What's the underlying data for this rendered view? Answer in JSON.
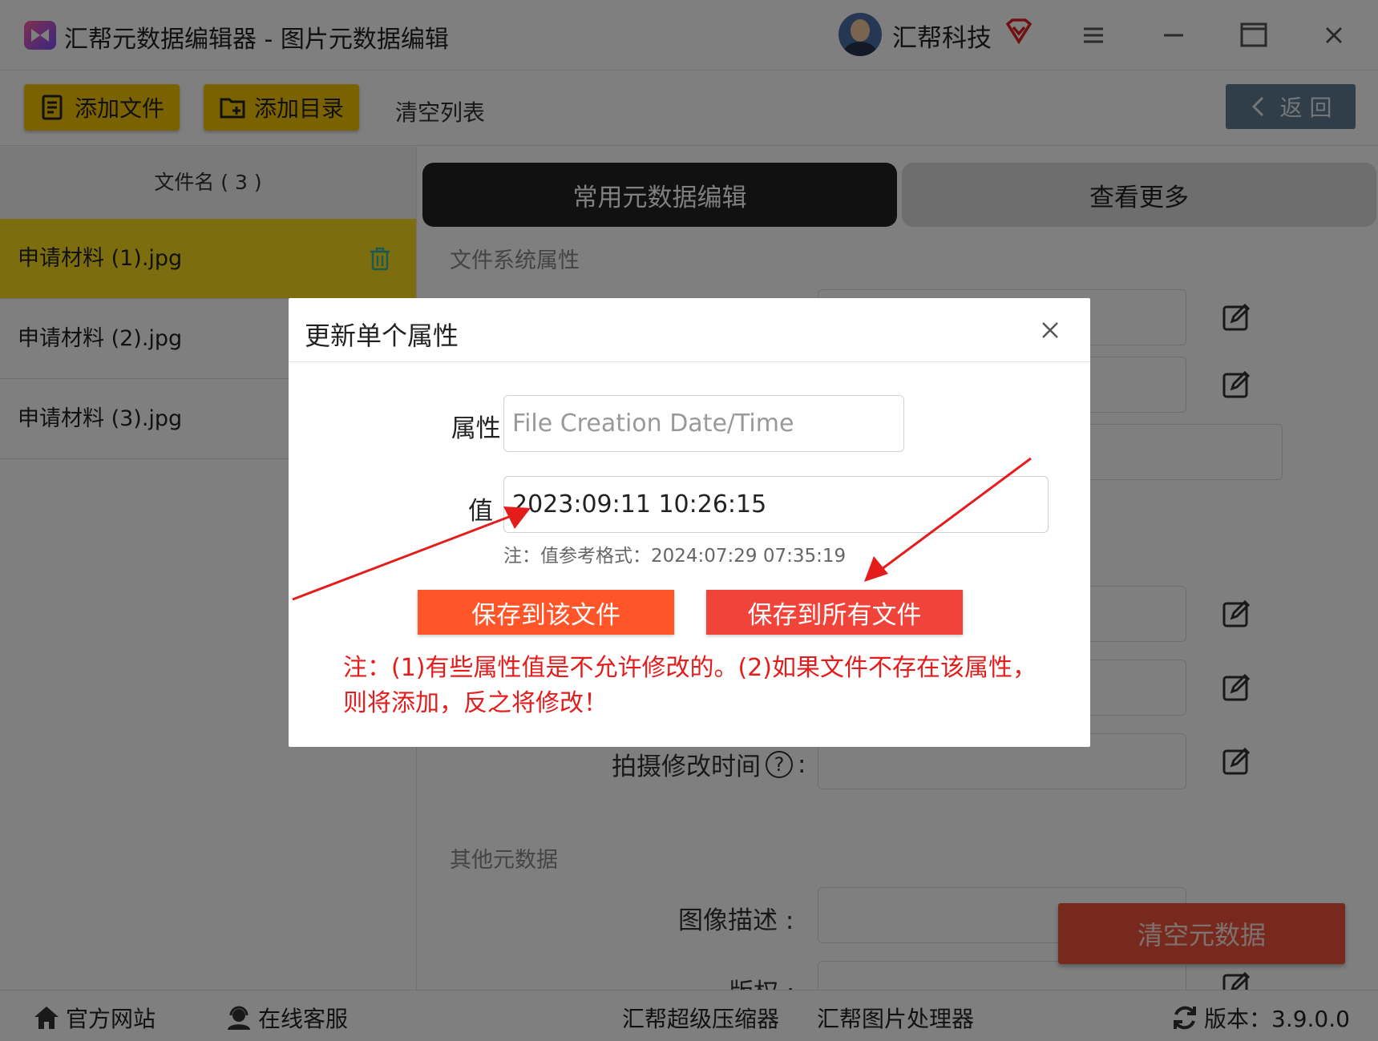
{
  "app": {
    "title": "汇帮元数据编辑器 - 图片元数据编辑"
  },
  "user": {
    "name": "汇帮科技"
  },
  "toolbar": {
    "add_file": "添加文件",
    "add_dir": "添加目录",
    "clear_list": "清空列表",
    "back": "返 回"
  },
  "file_list": {
    "header": "文件名 ( 3 )",
    "files": [
      {
        "name": "申请材料 (1).jpg",
        "active": true
      },
      {
        "name": "申请材料 (2).jpg",
        "active": false
      },
      {
        "name": "申请材料 (3).jpg",
        "active": false
      }
    ]
  },
  "main": {
    "tab_common": "常用元数据编辑",
    "tab_more": "查看更多",
    "section_fs": "文件系统属性",
    "section_other": "其他元数据",
    "label_shot_modified": "拍摄修改时间",
    "label_help": "?",
    "label_colon": ":",
    "label_image_desc": "图像描述 :",
    "label_copyright": "版权 :",
    "clear_metadata": "清空元数据"
  },
  "footer": {
    "site": "官方网站",
    "service": "在线客服",
    "compressor": "汇帮超级压缩器",
    "image_processor": "汇帮图片处理器",
    "version": "版本：3.9.0.0"
  },
  "modal": {
    "title": "更新单个属性",
    "attr_label": "属性 :",
    "attr_placeholder": "File Creation Date/Time",
    "value_label": "值",
    "value": "2023:09:11 10:26:15",
    "hint": "注：值参考格式：2024:07:29 07:35:19",
    "save_one": "保存到该文件",
    "save_all": "保存到所有文件",
    "note": "注：(1)有些属性值是不允许修改的。(2)如果文件不存在该属性，则将添加，反之将修改！"
  },
  "colors": {
    "accent_yellow": "#f7c500",
    "active_row": "#f9dd1c",
    "save_one": "#ff5528",
    "save_all": "#f0433a",
    "note_red": "#e51c1c",
    "clear_meta": "#f0533b"
  }
}
